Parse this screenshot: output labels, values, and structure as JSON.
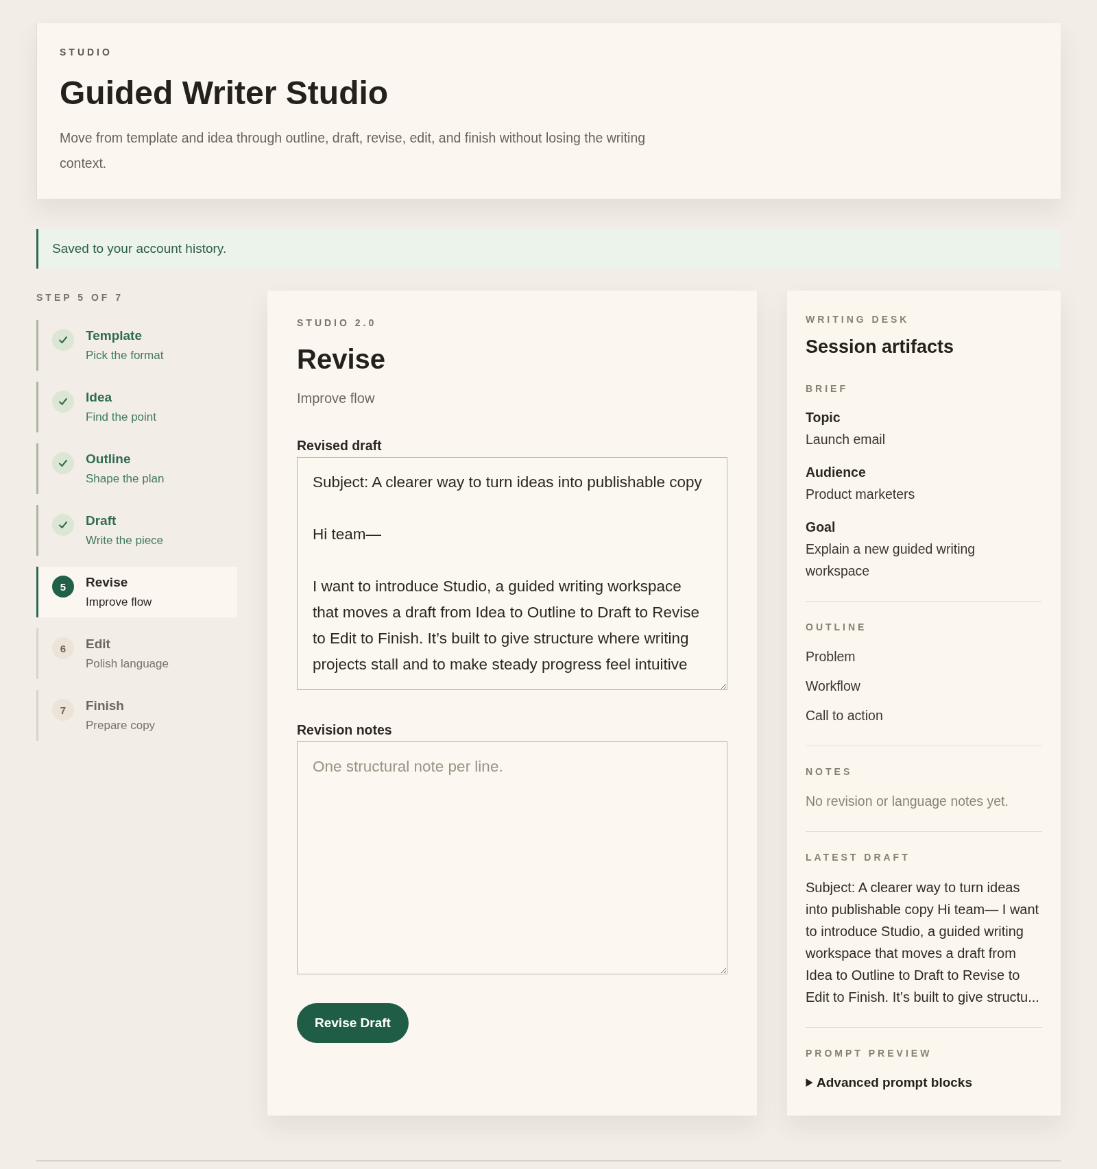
{
  "header": {
    "eyebrow": "STUDIO",
    "title": "Guided Writer Studio",
    "description": "Move from template and idea through outline, draft, revise, edit, and finish without losing the writing context."
  },
  "notice": {
    "text": "Saved to your account history."
  },
  "steps": {
    "counter": "STEP 5 OF 7",
    "items": [
      {
        "title": "Template",
        "subtitle": "Pick the format",
        "completed": true,
        "selected": false
      },
      {
        "title": "Idea",
        "subtitle": "Find the point",
        "completed": true,
        "selected": false
      },
      {
        "title": "Outline",
        "subtitle": "Shape the plan",
        "completed": true,
        "selected": false
      },
      {
        "title": "Draft",
        "subtitle": "Write the piece",
        "completed": true,
        "selected": false
      },
      {
        "number": "5",
        "title": "Revise",
        "subtitle": "Improve flow",
        "completed": false,
        "selected": true
      },
      {
        "number": "6",
        "title": "Edit",
        "subtitle": "Polish language",
        "completed": false,
        "selected": false
      },
      {
        "number": "7",
        "title": "Finish",
        "subtitle": "Prepare copy",
        "completed": false,
        "selected": false
      }
    ]
  },
  "editor": {
    "eyebrow": "STUDIO 2.0",
    "title": "Revise",
    "subtitle": "Improve flow",
    "fields": [
      {
        "label": "Revised draft",
        "value": "Subject: A clearer way to turn ideas into publishable copy\n\nHi team—\n\nI want to introduce Studio, a guided writing workspace that moves a draft from Idea to Outline to Draft to Revise to Edit to Finish. It’s built to give structure where writing projects stall and to make steady progress feel intuitive"
      },
      {
        "label": "Revision notes",
        "placeholder": "One structural note per line."
      }
    ],
    "button": "Revise Draft"
  },
  "desk": {
    "eyebrow": "WRITING DESK",
    "title": "Session artifacts",
    "sections": [
      {
        "kind": "fields",
        "heading": "BRIEF",
        "fields": [
          {
            "label": "Topic",
            "value": "Launch email"
          },
          {
            "label": "Audience",
            "value": "Product marketers"
          },
          {
            "label": "Goal",
            "value": "Explain a new guided writing workspace"
          }
        ]
      },
      {
        "kind": "list",
        "heading": "OUTLINE",
        "items": [
          "Problem",
          "Workflow",
          "Call to action"
        ]
      },
      {
        "kind": "message",
        "heading": "NOTES",
        "text": "No revision or language notes yet."
      },
      {
        "kind": "text",
        "heading": "LATEST DRAFT",
        "text": "Subject: A clearer way to turn ideas into publishable copy Hi team— I want to introduce Studio, a guided writing workspace that moves a draft from Idea to Outline to Draft to Revise to Edit to Finish. It’s built to give structu..."
      },
      {
        "kind": "disclosure",
        "heading": "PROMPT PREVIEW",
        "summary": "Advanced prompt blocks",
        "expanded": false
      }
    ]
  }
}
